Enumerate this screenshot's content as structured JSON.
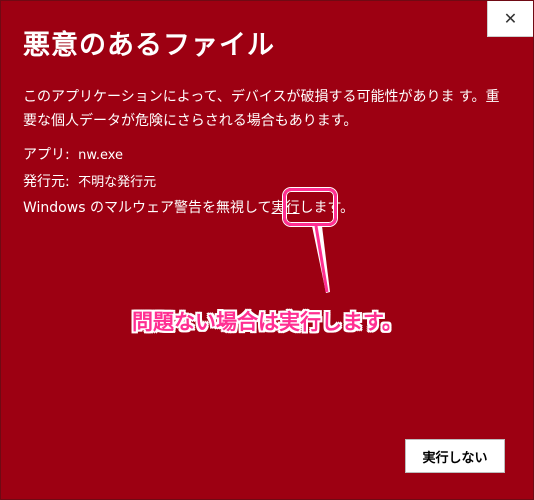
{
  "dialog": {
    "title": "悪意のあるファイル",
    "close_glyph": "✕",
    "description": "このアプリケーションによって、デバイスが破損する可能性がありま す。重要な個人データが危険にさらされる場合もあります。",
    "app_label": "アプリ:",
    "app_value": "nw.exe",
    "publisher_label": "発行元:",
    "publisher_value": "不明な発行元",
    "warning_prefix": "Windows のマルウェア警告を無視して",
    "run_link": "実行",
    "warning_suffix": "します。",
    "dont_run_button": "実行しない"
  },
  "annotation": {
    "callout_text": "問題ない場合は実行します。",
    "color": "#ff2f92"
  },
  "colors": {
    "dialog_background": "#9d0012",
    "text": "#ffffff"
  }
}
